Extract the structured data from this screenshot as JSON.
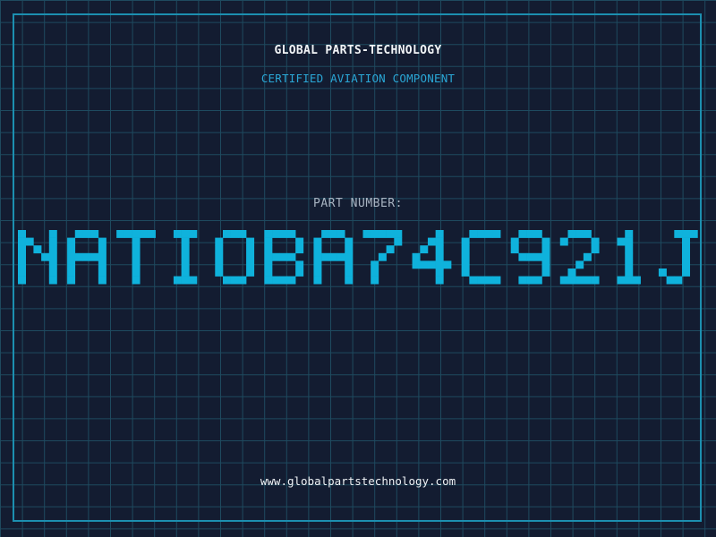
{
  "brand": "GLOBAL PARTS-TECHNOLOGY",
  "subtitle": "CERTIFIED AVIATION COMPONENT",
  "part_label": "PART NUMBER:",
  "part_number": "NATIOBA74C921J",
  "website": "www.globalpartstechnology.com",
  "colors": {
    "background": "#131c31",
    "grid": "#1e4a5f",
    "frame": "#1c8fb0",
    "accent": "#0fb2dc",
    "subtitle": "#2aa7d6",
    "label": "#a9b4c2",
    "text": "#f2f5f7"
  }
}
